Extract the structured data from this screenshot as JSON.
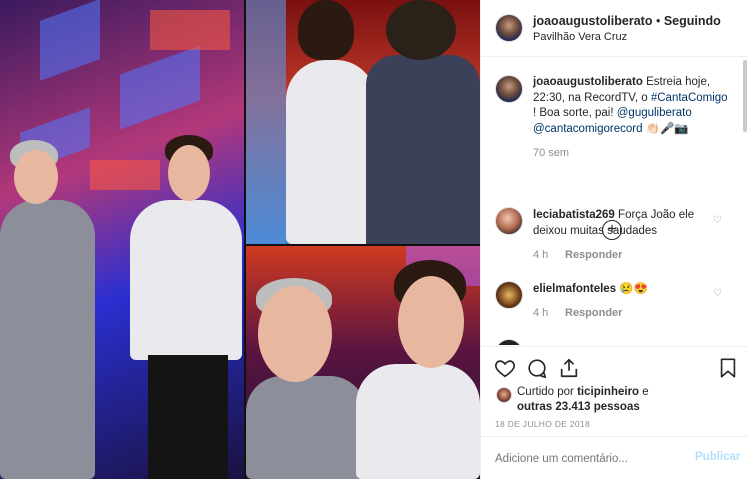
{
  "header": {
    "username": "joaoaugustoliberato",
    "separator": "•",
    "follow_status": "Seguindo",
    "location": "Pavilhão Vera Cruz"
  },
  "caption": {
    "username": "joaoaugustoliberato",
    "line1": "Estreia hoje,",
    "line2": "22:30, na RecordTV, o",
    "hashtag": "#CantaComigo",
    "line3_pre": "! Boa sorte, pai!",
    "mention1": "@guguliberato",
    "mention2": "@cantacomigorecord",
    "emojis": "👏🏻🎤📷",
    "time": "70 sem"
  },
  "comments": [
    {
      "username": "leciabatista269",
      "text_line1": "Força João ele",
      "text_line2": "deixou muitas saudades",
      "time": "4 h",
      "reply": "Responder"
    },
    {
      "username": "elielmafonteles",
      "text_line1": "😢😍",
      "text_line2": "",
      "time": "4 h",
      "reply": "Responder"
    }
  ],
  "actions": {
    "liked_by_pre": "Curtido por",
    "liked_by_user": "ticipinheiro",
    "liked_by_and": "e",
    "others": "outras 23.413 pessoas",
    "date": "18 DE JULHO DE 2018"
  },
  "add_comment": {
    "placeholder": "Adicione um comentário...",
    "publish": "Publicar"
  },
  "colors": {
    "link": "#003569",
    "muted": "#8e8e8e",
    "publish": "#b2dffc"
  },
  "icons": [
    "heart-icon",
    "comment-icon",
    "share-icon",
    "bookmark-icon",
    "add-circle-icon",
    "more-icon"
  ]
}
